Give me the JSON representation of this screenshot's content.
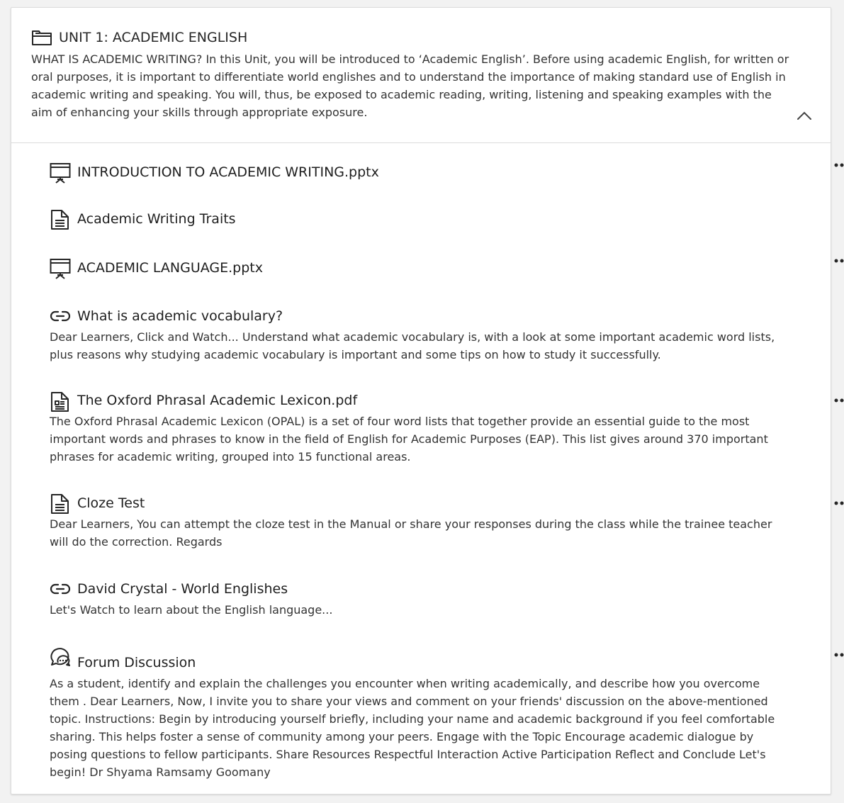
{
  "unit": {
    "title": "UNIT 1: ACADEMIC ENGLISH",
    "description": "WHAT IS ACADEMIC WRITING? In this Unit, you will be introduced to ‘Academic English’. Before using academic English, for written or oral purposes, it is important to differentiate world englishes and to understand the importance of making standard use of English in academic writing and speaking. You will, thus, be exposed to academic reading, writing, listening and speaking examples with the aim of enhancing your skills through appropriate exposure.",
    "icon": "folder-icon",
    "collapse_icon": "chevron-up-icon"
  },
  "items": [
    {
      "title": "INTRODUCTION TO ACADEMIC WRITING.pptx",
      "icon": "presentation-icon",
      "description": "",
      "has_menu": true
    },
    {
      "title": "Academic Writing Traits",
      "icon": "document-icon",
      "description": "",
      "has_menu": false
    },
    {
      "title": "ACADEMIC LANGUAGE.pptx",
      "icon": "presentation-icon",
      "description": "",
      "has_menu": true
    },
    {
      "title": "What is academic vocabulary?",
      "icon": "link-icon",
      "description": "Dear Learners, Click and Watch... Understand what academic vocabulary is, with a look at some important academic word lists, plus reasons why studying academic vocabulary is important and some tips on how to study it successfully.",
      "has_menu": false
    },
    {
      "title": "The Oxford Phrasal Academic Lexicon.pdf",
      "icon": "pdf-document-icon",
      "description": "The Oxford Phrasal Academic Lexicon (OPAL) is a set of four word lists that together provide an essential guide to the most important words and phrases to know in the field of English for Academic Purposes (EAP). This list gives around 370 important phrases for academic writing, grouped into 15 functional areas.",
      "has_menu": true
    },
    {
      "title": "Cloze Test",
      "icon": "document-icon",
      "description": "Dear Learners, You can attempt the cloze test in the Manual or share your responses during the class while the trainee teacher will do the correction. Regards",
      "has_menu": true
    },
    {
      "title": "David Crystal - World Englishes",
      "icon": "link-icon",
      "description": "Let's Watch to learn about the English language...",
      "has_menu": false
    },
    {
      "title": "Forum Discussion",
      "icon": "forum-icon",
      "description": "As a student, identify and explain the challenges you encounter when writing academically, and describe how you overcome them . Dear Learners, Now, I invite you to share your views and comment on your friends' discussion on the above-mentioned topic. Instructions: Begin by introducing yourself briefly, including your name and academic background if you feel comfortable sharing. This helps foster a sense of community among your peers. Engage with the Topic Encourage academic dialogue by posing questions to fellow participants. Share Resources Respectful Interaction Active Participation Reflect and Conclude Let's begin! Dr Shyama Ramsamy Goomany",
      "has_menu": true
    }
  ],
  "colors": {
    "text": "#262626",
    "border": "#dcdcdc",
    "background": "#f2f2f2",
    "card": "#ffffff"
  }
}
